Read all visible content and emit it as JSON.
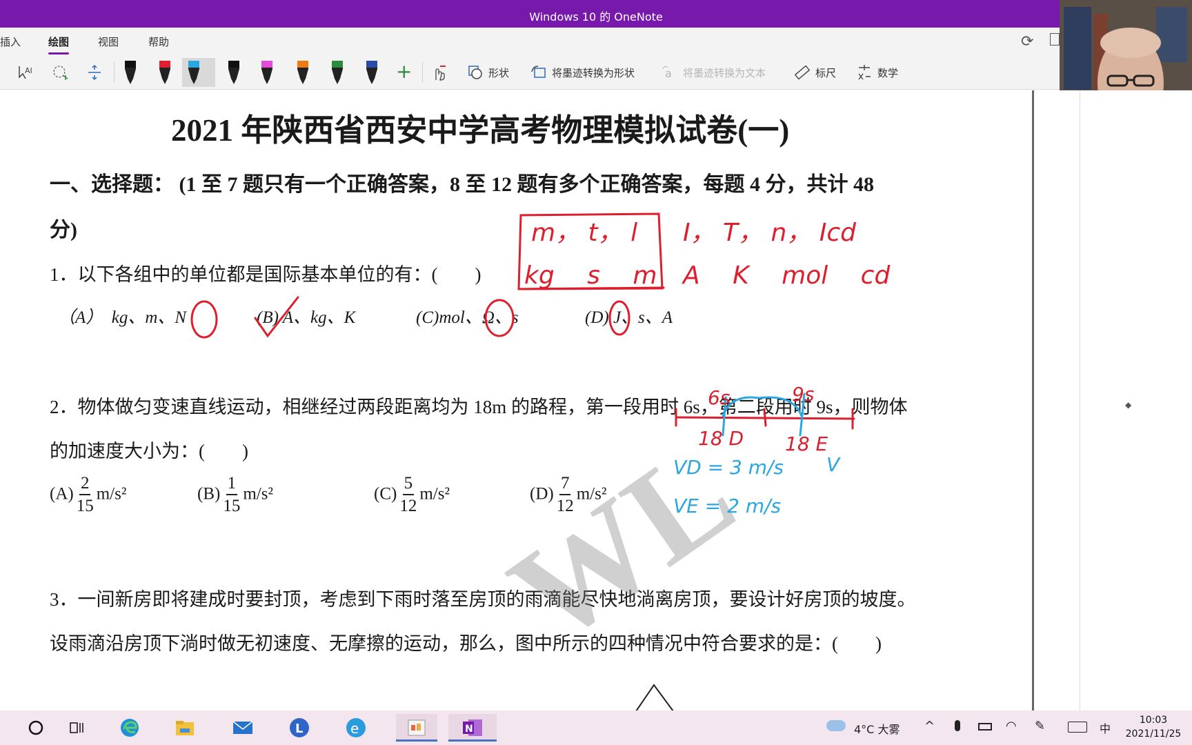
{
  "window": {
    "title": "Windows 10 的 OneNote"
  },
  "ribbon": {
    "tabs": [
      {
        "label": "插入"
      },
      {
        "label": "绘图"
      },
      {
        "label": "视图"
      },
      {
        "label": "帮助"
      }
    ],
    "tools": {
      "shapes": "形状",
      "ink_to_shape": "将墨迹转换为形状",
      "ink_to_text": "将墨迹转换为文本",
      "ruler": "标尺",
      "math": "数学"
    },
    "pen_colors": [
      "#111111",
      "#e0202f",
      "#2aa6e0",
      "#111111",
      "#e24cd9",
      "#f07a16",
      "#2a8c3c",
      "#2a4ca8"
    ]
  },
  "page": {
    "exam_title": "2021 年陕西省西安中学高考物理模拟试卷(一)",
    "section1_line1": "一、选择题： (1 至 7 题只有一个正确答案，8 至 12 题有多个正确答案，每题 4 分，共计 48",
    "section1_line2": "分)",
    "q1": {
      "stem": "1．以下各组中的单位都是国际基本单位的有：(　　)",
      "options": [
        "（A）　kg、m、N",
        "(B) A、kg、K",
        "(C)mol、Ω、s",
        "(D) J、s、A"
      ]
    },
    "q2": {
      "stem_line1": "2．物体做匀变速直线运动，相继经过两段距离均为 18m 的路程，第一段用时 6s，第二段用时 9s，则物体",
      "stem_line2": "的加速度大小为：(　　)",
      "options": [
        {
          "label": "(A)",
          "num": "2",
          "den": "15",
          "unit": "m/s²"
        },
        {
          "label": "(B)",
          "num": "1",
          "den": "15",
          "unit": "m/s²"
        },
        {
          "label": "(C)",
          "num": "5",
          "den": "12",
          "unit": "m/s²"
        },
        {
          "label": "(D)",
          "num": "7",
          "den": "12",
          "unit": "m/s²"
        }
      ]
    },
    "q3": {
      "line1": "3．一间新房即将建成时要封顶，考虑到下雨时落至房顶的雨滴能尽快地淌离房顶，要设计好房顶的坡度。",
      "line2": "设雨滴沿房顶下淌时做无初速度、无摩擦的运动，那么，图中所示的四种情况中符合要求的是：(　　)"
    },
    "watermark": "WL"
  },
  "ink": {
    "box_row1": "m， t， l",
    "box_row2": "kg　 s　 m",
    "row1_rest": "I， T， n， Icd",
    "row2_rest": "A　 K　 mol　 cd",
    "diag_left_time": "6s",
    "diag_right_time": "9s",
    "diag_left_dist": "18 D",
    "diag_right_dist": "18 E",
    "diag_v": "V",
    "vd": "VD = 3 m/s",
    "ve": "VE = 2 m/s"
  },
  "taskbar": {
    "weather": "4°C 大雾",
    "ime": "中",
    "time": "10:03",
    "date": "2021/11/25"
  }
}
